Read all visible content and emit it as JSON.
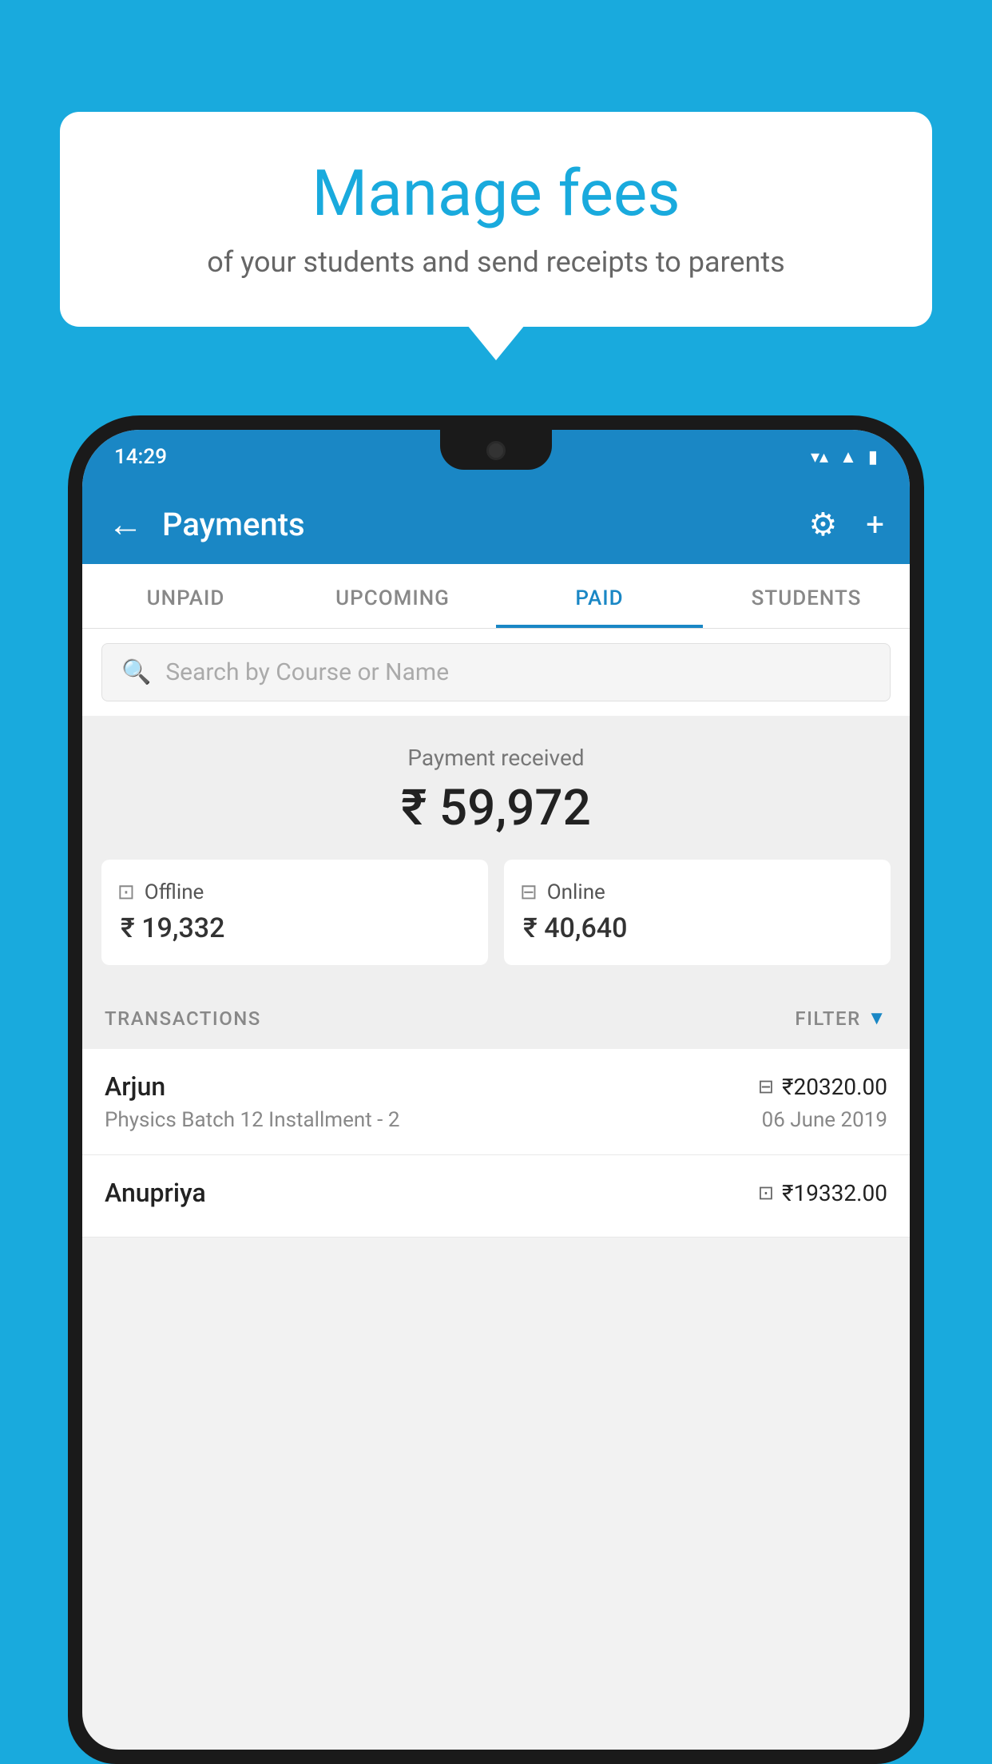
{
  "page": {
    "background_color": "#19AADD"
  },
  "bubble": {
    "title": "Manage fees",
    "subtitle": "of your students and send receipts to parents"
  },
  "status_bar": {
    "time": "14:29",
    "wifi_icon": "▼",
    "signal_icon": "▲",
    "battery_icon": "▮"
  },
  "app_bar": {
    "back_label": "←",
    "title": "Payments",
    "gear_label": "⚙",
    "plus_label": "+"
  },
  "tabs": [
    {
      "label": "UNPAID",
      "active": false
    },
    {
      "label": "UPCOMING",
      "active": false
    },
    {
      "label": "PAID",
      "active": true
    },
    {
      "label": "STUDENTS",
      "active": false
    }
  ],
  "search": {
    "placeholder": "Search by Course or Name"
  },
  "payment_summary": {
    "label": "Payment received",
    "amount": "₹ 59,972",
    "offline": {
      "type": "Offline",
      "amount": "₹ 19,332"
    },
    "online": {
      "type": "Online",
      "amount": "₹ 40,640"
    }
  },
  "transactions": {
    "header_label": "TRANSACTIONS",
    "filter_label": "FILTER",
    "items": [
      {
        "name": "Arjun",
        "amount": "₹20320.00",
        "payment_type": "online",
        "course": "Physics Batch 12 Installment - 2",
        "date": "06 June 2019"
      },
      {
        "name": "Anupriya",
        "amount": "₹19332.00",
        "payment_type": "offline",
        "course": "",
        "date": ""
      }
    ]
  }
}
